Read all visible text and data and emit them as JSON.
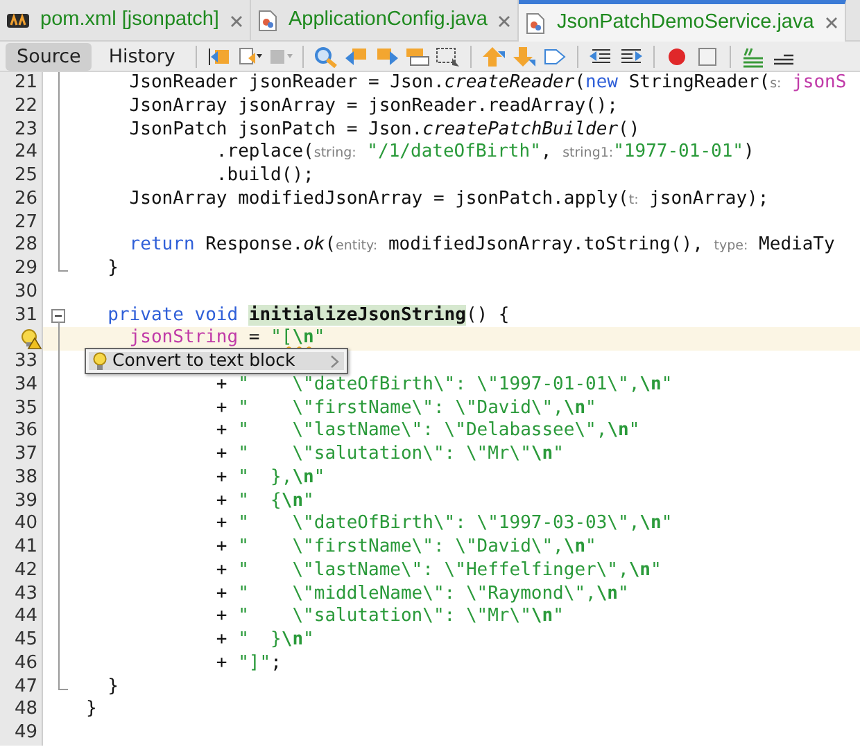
{
  "tabs": [
    {
      "label": "pom.xml [jsonpatch]",
      "kind": "maven",
      "selected": false
    },
    {
      "label": "ApplicationConfig.java",
      "kind": "java",
      "selected": false
    },
    {
      "label": "JsonPatchDemoService.java",
      "kind": "java",
      "selected": true
    }
  ],
  "views": [
    {
      "label": "Source",
      "selected": true
    },
    {
      "label": "History",
      "selected": false
    }
  ],
  "lines": [
    {
      "number": "21",
      "in_fold": true,
      "segments": [
        {
          "kind": "plain",
          "text": "    JsonReader jsonReader = Json."
        },
        {
          "kind": "italic",
          "text": "createReader"
        },
        {
          "kind": "plain",
          "text": "("
        },
        {
          "kind": "keyword",
          "text": "new"
        },
        {
          "kind": "plain",
          "text": " StringReader("
        },
        {
          "kind": "hint",
          "text": "s:"
        },
        {
          "kind": "field",
          "text": " jsonS"
        }
      ]
    },
    {
      "number": "22",
      "in_fold": true,
      "segments": [
        {
          "kind": "plain",
          "text": "    JsonArray jsonArray = jsonReader.readArray();"
        }
      ]
    },
    {
      "number": "23",
      "in_fold": true,
      "segments": [
        {
          "kind": "plain",
          "text": "    JsonPatch jsonPatch = Json."
        },
        {
          "kind": "italic",
          "text": "createPatchBuilder"
        },
        {
          "kind": "plain",
          "text": "()"
        }
      ]
    },
    {
      "number": "24",
      "in_fold": true,
      "segments": [
        {
          "kind": "plain",
          "text": "            .replace("
        },
        {
          "kind": "hint",
          "text": "string:"
        },
        {
          "kind": "string",
          "text": " \"/1/dateOfBirth\""
        },
        {
          "kind": "plain",
          "text": ", "
        },
        {
          "kind": "hint",
          "text": "string1:"
        },
        {
          "kind": "string",
          "text": "\"1977-01-01\""
        },
        {
          "kind": "plain",
          "text": ")"
        }
      ]
    },
    {
      "number": "25",
      "in_fold": true,
      "segments": [
        {
          "kind": "plain",
          "text": "            .build();"
        }
      ]
    },
    {
      "number": "26",
      "in_fold": true,
      "segments": [
        {
          "kind": "plain",
          "text": "    JsonArray modifiedJsonArray = jsonPatch.apply("
        },
        {
          "kind": "hint",
          "text": "t:"
        },
        {
          "kind": "plain",
          "text": " jsonArray);"
        }
      ]
    },
    {
      "number": "27",
      "in_fold": true
    },
    {
      "number": "28",
      "in_fold": true,
      "segments": [
        {
          "kind": "keyword",
          "text": "    return"
        },
        {
          "kind": "plain",
          "text": " Response."
        },
        {
          "kind": "italic",
          "text": "ok"
        },
        {
          "kind": "plain",
          "text": "("
        },
        {
          "kind": "hint",
          "text": "entity:"
        },
        {
          "kind": "plain",
          "text": " modifiedJsonArray.toString(), "
        },
        {
          "kind": "hint",
          "text": "type:"
        },
        {
          "kind": "plain",
          "text": " MediaTy"
        }
      ]
    },
    {
      "number": "29",
      "fold_end": true,
      "segments": [
        {
          "kind": "plain",
          "text": "  }"
        }
      ]
    },
    {
      "number": "30"
    },
    {
      "number": "31",
      "fold_start": true,
      "segments": [
        {
          "kind": "keyword",
          "text": "  private void "
        },
        {
          "kind": "method",
          "text": "initializeJsonString"
        },
        {
          "kind": "plain",
          "text": "() {"
        }
      ]
    },
    {
      "hint_available": true,
      "current": true,
      "in_fold": true,
      "segments": [
        {
          "kind": "field",
          "text": "    jsonString"
        },
        {
          "kind": "plain",
          "text": " = "
        },
        {
          "kind": "string",
          "text": "\""
        },
        {
          "kind": "string_warn",
          "text": "["
        },
        {
          "kind": "escape_warn",
          "text": "\\n"
        },
        {
          "kind": "string",
          "text": "\""
        }
      ]
    },
    {
      "number": "33",
      "in_fold": true
    },
    {
      "number": "34",
      "in_fold": true,
      "segments": [
        {
          "kind": "plain",
          "text": "            + "
        },
        {
          "kind": "string",
          "text": "\"    \\\"dateOfBirth\\\": \\\"1997-01-01\\\","
        },
        {
          "kind": "escape",
          "text": "\\n"
        },
        {
          "kind": "string",
          "text": "\""
        }
      ]
    },
    {
      "number": "35",
      "in_fold": true,
      "segments": [
        {
          "kind": "plain",
          "text": "            + "
        },
        {
          "kind": "string",
          "text": "\"    \\\"firstName\\\": \\\"David\\\","
        },
        {
          "kind": "escape",
          "text": "\\n"
        },
        {
          "kind": "string",
          "text": "\""
        }
      ]
    },
    {
      "number": "36",
      "in_fold": true,
      "segments": [
        {
          "kind": "plain",
          "text": "            + "
        },
        {
          "kind": "string",
          "text": "\"    \\\"lastName\\\": \\\"Delabassee\\\","
        },
        {
          "kind": "escape",
          "text": "\\n"
        },
        {
          "kind": "string",
          "text": "\""
        }
      ]
    },
    {
      "number": "37",
      "in_fold": true,
      "segments": [
        {
          "kind": "plain",
          "text": "            + "
        },
        {
          "kind": "string",
          "text": "\"    \\\"salutation\\\": \\\"Mr\\\""
        },
        {
          "kind": "escape",
          "text": "\\n"
        },
        {
          "kind": "string",
          "text": "\""
        }
      ]
    },
    {
      "number": "38",
      "in_fold": true,
      "segments": [
        {
          "kind": "plain",
          "text": "            + "
        },
        {
          "kind": "string",
          "text": "\"  },"
        },
        {
          "kind": "escape",
          "text": "\\n"
        },
        {
          "kind": "string",
          "text": "\""
        }
      ]
    },
    {
      "number": "39",
      "in_fold": true,
      "segments": [
        {
          "kind": "plain",
          "text": "            + "
        },
        {
          "kind": "string",
          "text": "\"  {"
        },
        {
          "kind": "escape",
          "text": "\\n"
        },
        {
          "kind": "string",
          "text": "\""
        }
      ]
    },
    {
      "number": "40",
      "in_fold": true,
      "segments": [
        {
          "kind": "plain",
          "text": "            + "
        },
        {
          "kind": "string",
          "text": "\"    \\\"dateOfBirth\\\": \\\"1997-03-03\\\","
        },
        {
          "kind": "escape",
          "text": "\\n"
        },
        {
          "kind": "string",
          "text": "\""
        }
      ]
    },
    {
      "number": "41",
      "in_fold": true,
      "segments": [
        {
          "kind": "plain",
          "text": "            + "
        },
        {
          "kind": "string",
          "text": "\"    \\\"firstName\\\": \\\"David\\\","
        },
        {
          "kind": "escape",
          "text": "\\n"
        },
        {
          "kind": "string",
          "text": "\""
        }
      ]
    },
    {
      "number": "42",
      "in_fold": true,
      "segments": [
        {
          "kind": "plain",
          "text": "            + "
        },
        {
          "kind": "string",
          "text": "\"    \\\"lastName\\\": \\\"Heffelfinger\\\","
        },
        {
          "kind": "escape",
          "text": "\\n"
        },
        {
          "kind": "string",
          "text": "\""
        }
      ]
    },
    {
      "number": "43",
      "in_fold": true,
      "segments": [
        {
          "kind": "plain",
          "text": "            + "
        },
        {
          "kind": "string",
          "text": "\"    \\\"middleName\\\": \\\"Raymond\\\","
        },
        {
          "kind": "escape",
          "text": "\\n"
        },
        {
          "kind": "string",
          "text": "\""
        }
      ]
    },
    {
      "number": "44",
      "in_fold": true,
      "segments": [
        {
          "kind": "plain",
          "text": "            + "
        },
        {
          "kind": "string",
          "text": "\"    \\\"salutation\\\": \\\"Mr\\\""
        },
        {
          "kind": "escape",
          "text": "\\n"
        },
        {
          "kind": "string",
          "text": "\""
        }
      ]
    },
    {
      "number": "45",
      "in_fold": true,
      "segments": [
        {
          "kind": "plain",
          "text": "            + "
        },
        {
          "kind": "string",
          "text": "\"  }"
        },
        {
          "kind": "escape",
          "text": "\\n"
        },
        {
          "kind": "string",
          "text": "\""
        }
      ]
    },
    {
      "number": "46",
      "in_fold": true,
      "segments": [
        {
          "kind": "plain",
          "text": "            + "
        },
        {
          "kind": "string",
          "text": "\"]\""
        },
        {
          "kind": "plain",
          "text": ";"
        }
      ]
    },
    {
      "number": "47",
      "fold_end": true,
      "segments": [
        {
          "kind": "plain",
          "text": "  }"
        }
      ]
    },
    {
      "number": "48",
      "segments": [
        {
          "kind": "plain",
          "text": "}"
        }
      ]
    },
    {
      "number": "49"
    }
  ],
  "popup": {
    "label": "Convert to text block"
  }
}
